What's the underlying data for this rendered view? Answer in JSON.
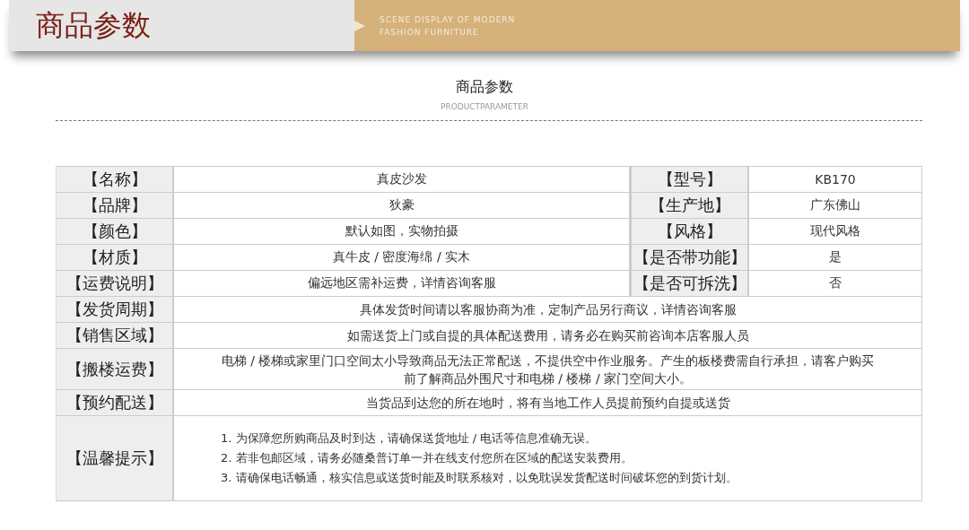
{
  "header": {
    "title": "商品参数",
    "tagline": [
      "SCENE DISPLAY OF MODERN",
      "FASHION FURNITURE"
    ]
  },
  "section": {
    "title": "商品参数",
    "subtitle": "PRODUCTPARAMETER"
  },
  "rows": [
    {
      "kind": "pair",
      "cells": [
        {
          "label": "【名称】",
          "value": "真皮沙发"
        },
        {
          "label": "【型号】",
          "value": "KB170"
        }
      ]
    },
    {
      "kind": "pair",
      "cells": [
        {
          "label": "【品牌】",
          "value": "狄豪"
        },
        {
          "label": "【生产地】",
          "value": "广东佛山"
        }
      ]
    },
    {
      "kind": "pair",
      "cells": [
        {
          "label": "【颜色】",
          "value": "默认如图，实物拍摄"
        },
        {
          "label": "【风格】",
          "value": "现代风格"
        }
      ]
    },
    {
      "kind": "pair",
      "cells": [
        {
          "label": "【材质】",
          "value": "真牛皮 / 密度海绵 / 实木"
        },
        {
          "label": "【是否带功能】",
          "value": "是"
        }
      ]
    },
    {
      "kind": "pair",
      "cells": [
        {
          "label": "【运费说明】",
          "value": "偏远地区需补运费，详情咨询客服"
        },
        {
          "label": "【是否可拆洗】",
          "value": "否"
        }
      ]
    },
    {
      "kind": "full",
      "label": "【发货周期】",
      "value": "具体发货时间请以客服协商为准，定制产品另行商议，详情咨询客服"
    },
    {
      "kind": "full",
      "label": "【销售区域】",
      "value": "如需送货上门或自提的具体配送费用，请务必在购买前咨询本店客服人员"
    },
    {
      "kind": "full",
      "label": "【搬楼运费】",
      "value": "电梯 / 楼梯或家里门口空间太小导致商品无法正常配送，不提供空中作业服务。产生的板楼费需自行承担，请客户购买前了解商品外围尺寸和电梯 / 楼梯 / 家门空间大小。"
    },
    {
      "kind": "full",
      "label": "【预约配送】",
      "value": "当货品到达您的所在地时，将有当地工作人员提前预约自提或送货"
    },
    {
      "kind": "list",
      "label": "【温馨提示】",
      "items": [
        "1. 为保障您所购商品及时到达，请确保送货地址 / 电话等信息准确无误。",
        "2. 若非包邮区域，请务必随桑普订单一并在线支付您所在区域的配送安装费用。",
        "3. 请确保电话畅通，核实信息或送货时能及时联系核对，以免耽误发货配送时间破坏您的到货计划。"
      ]
    }
  ]
}
